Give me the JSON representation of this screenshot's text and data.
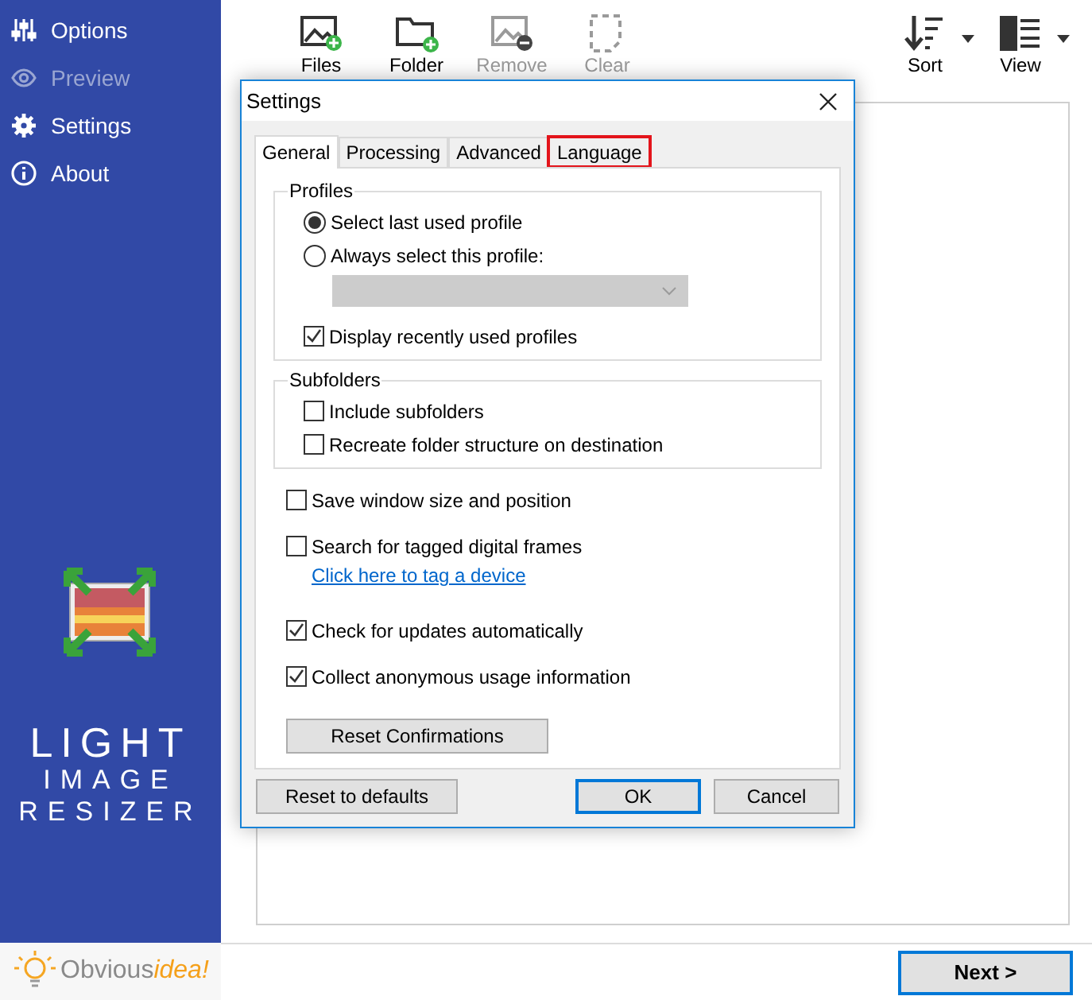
{
  "sidebar": {
    "items": [
      {
        "label": "Options",
        "disabled": false
      },
      {
        "label": "Preview",
        "disabled": true
      },
      {
        "label": "Settings",
        "disabled": false
      },
      {
        "label": "About",
        "disabled": false
      }
    ]
  },
  "logo": {
    "lines": [
      "LIGHT",
      "IMAGE",
      "RESIZER"
    ]
  },
  "brand": [
    "Obvious",
    "idea!"
  ],
  "toolbar": {
    "left": [
      {
        "label": "Files",
        "disabled": false
      },
      {
        "label": "Folder",
        "disabled": false
      },
      {
        "label": "Remove",
        "disabled": true
      },
      {
        "label": "Clear",
        "disabled": true
      }
    ],
    "right": [
      {
        "label": "Sort"
      },
      {
        "label": "View"
      }
    ]
  },
  "next_button": "Next >",
  "dialog": {
    "title": "Settings",
    "tabs": [
      {
        "label": "General",
        "selected": true,
        "highlighted": false
      },
      {
        "label": "Processing",
        "selected": false,
        "highlighted": false
      },
      {
        "label": "Advanced",
        "selected": false,
        "highlighted": false
      },
      {
        "label": "Language",
        "selected": false,
        "highlighted": true
      }
    ],
    "sections": [
      {
        "kind": "group",
        "title": "Profiles",
        "items": [
          {
            "kind": "radio",
            "label": "Select last used profile",
            "selected": true
          },
          {
            "kind": "radio",
            "label": "Always select this profile:",
            "selected": false
          },
          {
            "kind": "select",
            "disabled": true
          },
          {
            "kind": "checkbox",
            "label": "Display recently used profiles",
            "checked": true
          }
        ]
      },
      {
        "kind": "group",
        "title": "Subfolders",
        "items": [
          {
            "kind": "checkbox",
            "label": "Include subfolders",
            "checked": false
          },
          {
            "kind": "checkbox",
            "label": "Recreate folder structure on destination",
            "checked": false
          }
        ]
      },
      {
        "kind": "checkbox",
        "label": "Save window size and position",
        "checked": false
      },
      {
        "kind": "checkbox",
        "label": "Search for tagged digital frames",
        "checked": false
      },
      {
        "kind": "link",
        "label": "Click here to tag a device"
      },
      {
        "kind": "checkbox",
        "label": "Check for updates automatically",
        "checked": true
      },
      {
        "kind": "checkbox",
        "label": "Collect anonymous usage information",
        "checked": true
      },
      {
        "kind": "button",
        "label": "Reset Confirmations"
      }
    ],
    "buttons": [
      {
        "label": "Reset to defaults",
        "default": false
      },
      {
        "label": "OK",
        "default": true
      },
      {
        "label": "Cancel",
        "default": false
      }
    ]
  }
}
